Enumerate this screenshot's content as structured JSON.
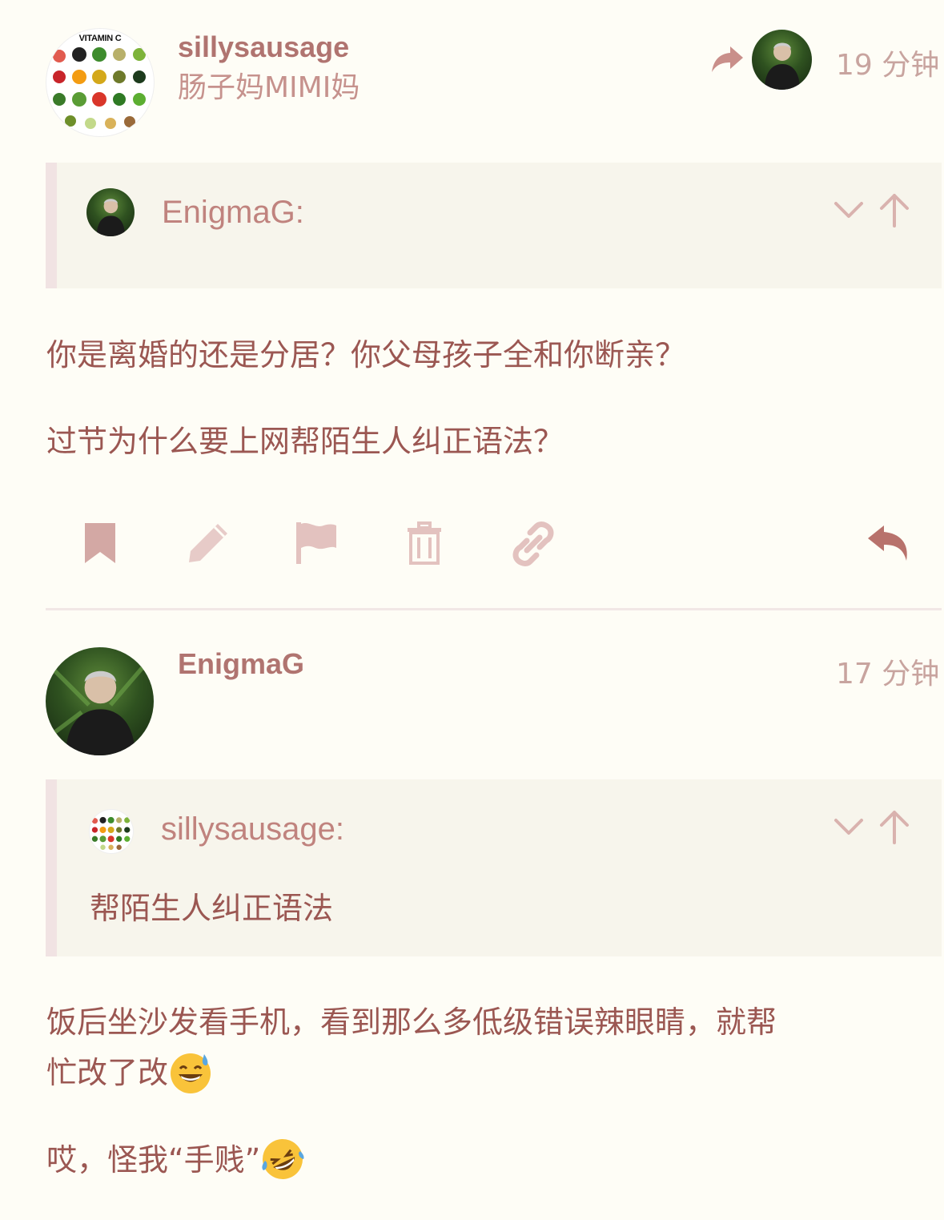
{
  "post1": {
    "username": "sillysausage",
    "fullname": "肠子妈MIMI妈",
    "time": "19 分钟",
    "avatar_label": "VITAMIN C",
    "quote": {
      "name": "EnigmaG:"
    },
    "paragraphs": [
      "你是离婚的还是分居？你父母孩子全和你断亲？",
      "过节为什么要上网帮陌生人纠正语法？"
    ],
    "actions": [
      "bookmark-icon",
      "pencil-icon",
      "flag-icon",
      "trash-icon",
      "link-icon",
      "reply-icon"
    ]
  },
  "post2": {
    "username": "EnigmaG",
    "time": "17 分钟",
    "quote": {
      "name": "sillysausage:",
      "text": "帮陌生人纠正语法"
    },
    "line1": "饭后坐沙发看手机，看到那么多低级错误辣眼睛，就帮",
    "line2": "忙改了改",
    "line3": "哎，怪我“手贱”"
  },
  "colors": {
    "background": "#fefdf6",
    "accent": "#b07470",
    "quote_bg": "#f7f5ec",
    "quote_bar": "#f1e3e3"
  }
}
